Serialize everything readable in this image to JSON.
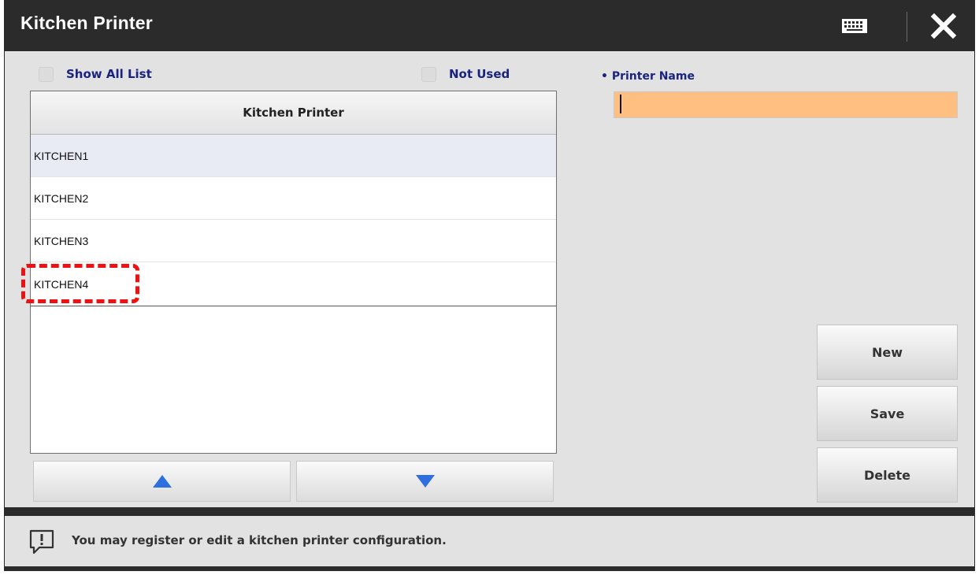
{
  "window": {
    "title": "Kitchen Printer",
    "accent_color": "#2b2b2b",
    "input_color": "#ffbf80"
  },
  "titlebar": {
    "keyboard_icon": "keyboard-icon",
    "close_icon": "close-icon"
  },
  "filters": {
    "show_all_list": "Show All List",
    "not_used": "Not Used"
  },
  "list": {
    "header": "Kitchen Printer",
    "rows": [
      "KITCHEN1",
      "KITCHEN2",
      "KITCHEN3",
      "KITCHEN4"
    ],
    "selected_index": 0,
    "up_icon": "arrow-up-icon",
    "down_icon": "arrow-down-icon"
  },
  "form": {
    "printer_name_label": "• Printer Name",
    "printer_name_value": ""
  },
  "actions": {
    "new": "New",
    "save": "Save",
    "delete": "Delete"
  },
  "status": {
    "icon": "info-message-icon",
    "message": "You may register or edit a kitchen printer configuration."
  }
}
